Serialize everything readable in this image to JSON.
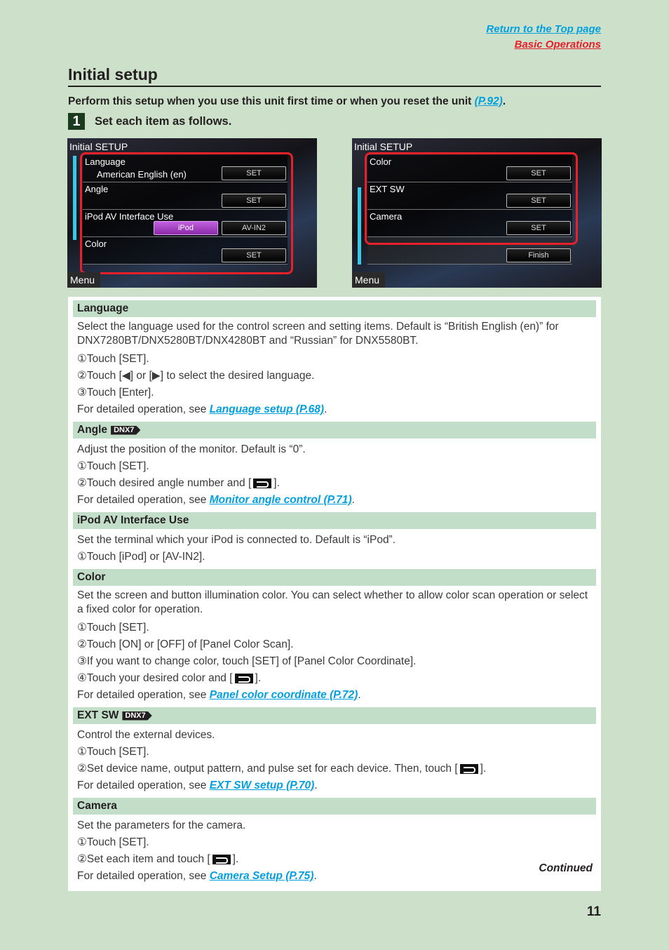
{
  "nav": {
    "top_page": "Return to the Top page",
    "basic_ops": "Basic Operations"
  },
  "title": "Initial setup",
  "intro": {
    "text": "Perform this setup when you use this unit first time or when you reset the unit ",
    "link": "(P.92)",
    "end": "."
  },
  "step": {
    "num": "1",
    "text": "Set each item as follows."
  },
  "screen1": {
    "title": "Initial SETUP",
    "rows": [
      {
        "label": "Language",
        "value": "American English (en)",
        "button": "SET"
      },
      {
        "label": "Angle",
        "value": "",
        "button": "SET"
      },
      {
        "label": "iPod AV Interface Use",
        "option_on": "iPod",
        "button": "AV-IN2"
      },
      {
        "label": "Color",
        "value": "",
        "button": "SET"
      }
    ],
    "menu": "Menu"
  },
  "screen2": {
    "title": "Initial SETUP",
    "rows": [
      {
        "label": "Color",
        "button": "SET"
      },
      {
        "label": "EXT SW",
        "button": "SET"
      },
      {
        "label": "Camera",
        "button": "SET"
      }
    ],
    "finish": "Finish",
    "menu": "Menu"
  },
  "sections": {
    "language": {
      "head": "Language",
      "desc": "Select the language used for the control screen and setting items. Default is “British English (en)” for DNX7280BT/DNX5280BT/DNX4280BT and “Russian” for DNX5580BT.",
      "s1": "①Touch [SET].",
      "s2": "②Touch [◀] or [▶] to select the desired language.",
      "s3": "③Touch [Enter].",
      "see": "For detailed operation, see ",
      "link": "Language setup (P.68)"
    },
    "angle": {
      "head": "Angle",
      "tag": "DNX7",
      "desc": "Adjust the position of the monitor. Default is “0”.",
      "s1": "①Touch [SET].",
      "s2a": "②Touch desired angle number and [",
      "s2b": "].",
      "see": "For detailed operation, see ",
      "link": "Monitor angle control (P.71)"
    },
    "ipod": {
      "head": "iPod AV Interface Use",
      "desc": "Set the terminal which your iPod is connected to. Default is “iPod”.",
      "s1": "①Touch [iPod] or [AV-IN2]."
    },
    "color": {
      "head": "Color",
      "desc": "Set the screen and button illumination color. You can select whether to allow color scan operation or select a fixed color for operation.",
      "s1": "①Touch [SET].",
      "s2": "②Touch [ON] or [OFF] of [Panel Color Scan].",
      "s3": "③If you want to change color, touch [SET] of [Panel Color Coordinate].",
      "s4a": "④Touch your desired color and [",
      "s4b": "].",
      "see": "For detailed operation, see ",
      "link": "Panel color coordinate (P.72)"
    },
    "extsw": {
      "head": "EXT SW",
      "tag": "DNX7",
      "desc": "Control the external devices.",
      "s1": "①Touch [SET].",
      "s2a": "②Set device name, output pattern, and pulse set for each device. Then, touch [",
      "s2b": "].",
      "see": "For detailed operation, see ",
      "link": "EXT SW setup (P.70)"
    },
    "camera": {
      "head": "Camera",
      "desc": "Set the parameters for the camera.",
      "s1": "①Touch [SET].",
      "s2a": "②Set each item and touch [",
      "s2b": "].",
      "see": "For detailed operation, see ",
      "link": "Camera Setup (P.75)"
    }
  },
  "continued": "Continued",
  "page_number": "11"
}
